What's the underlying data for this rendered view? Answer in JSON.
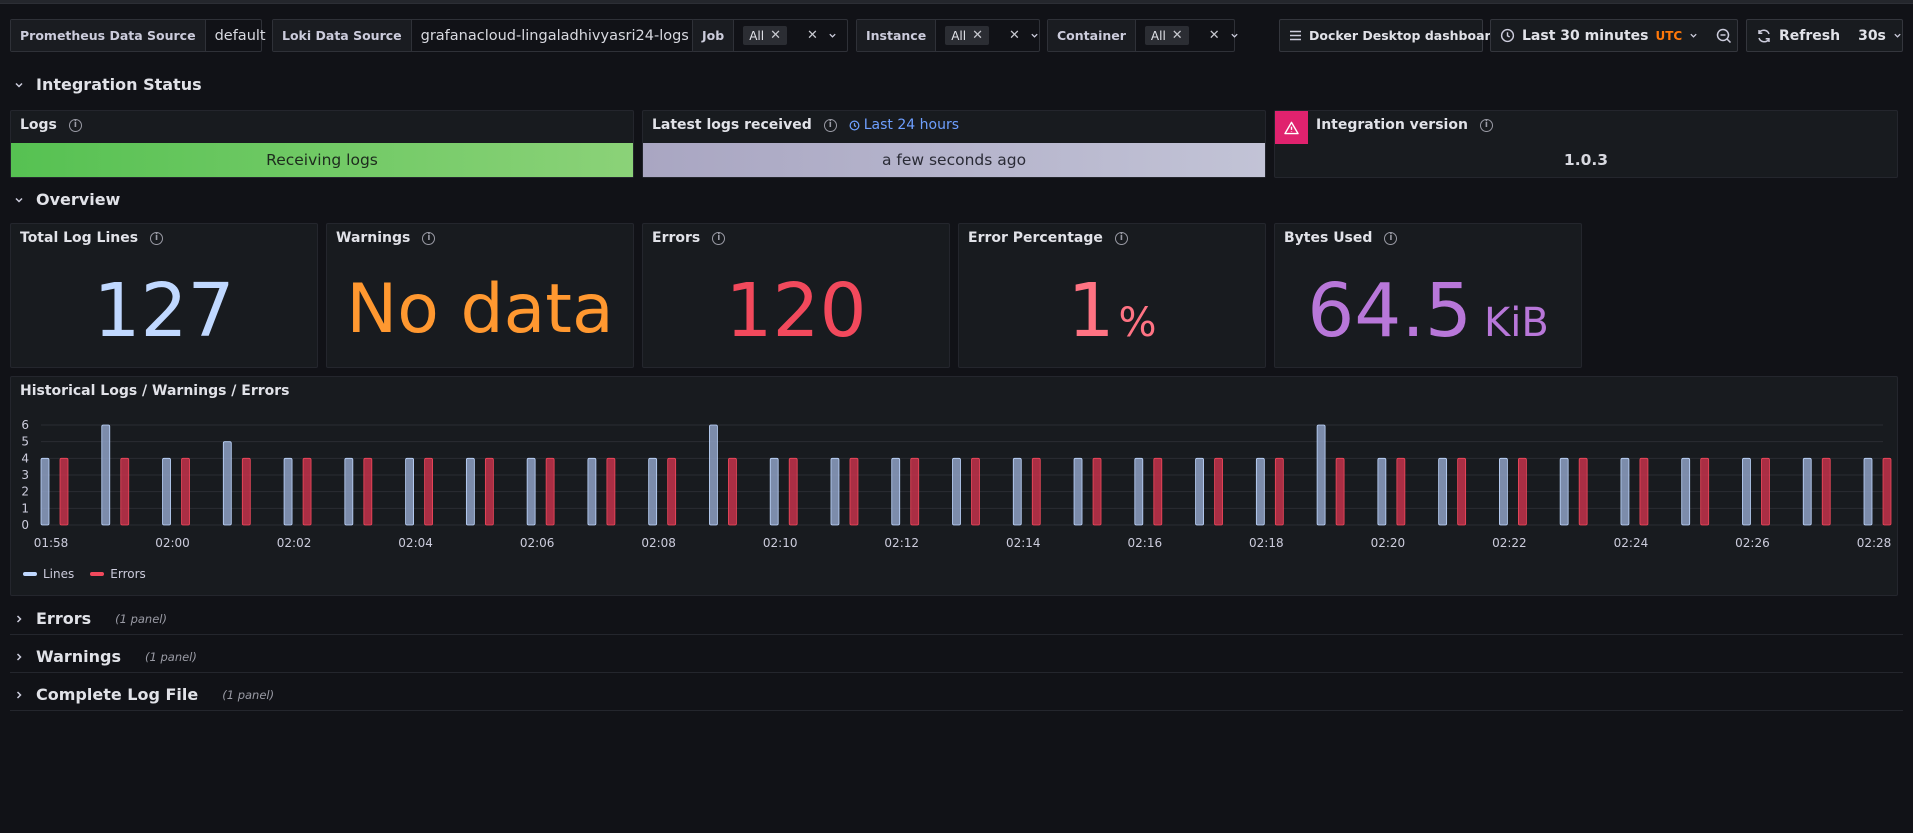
{
  "variables": {
    "prometheus": {
      "label": "Prometheus Data Source",
      "value": "default"
    },
    "loki": {
      "label": "Loki Data Source",
      "value": "grafanacloud-lingaladhivyasri24-logs"
    },
    "job": {
      "label": "Job",
      "value": "All"
    },
    "instance": {
      "label": "Instance",
      "value": "All"
    },
    "container": {
      "label": "Container",
      "value": "All"
    }
  },
  "toolbar": {
    "dashboards_link": "Docker Desktop dashboards",
    "time_range": "Last 30 minutes",
    "timezone": "UTC",
    "refresh_label": "Refresh",
    "refresh_interval": "30s"
  },
  "rows": {
    "integration_status": "Integration Status",
    "overview": "Overview",
    "errors": {
      "title": "Errors",
      "count": "(1 panel)"
    },
    "warnings": {
      "title": "Warnings",
      "count": "(1 panel)"
    },
    "complete_log": {
      "title": "Complete Log File",
      "count": "(1 panel)"
    }
  },
  "status_panels": {
    "logs": {
      "title": "Logs",
      "value": "Receiving logs"
    },
    "latest": {
      "title": "Latest logs received",
      "time_link": "Last 24 hours",
      "value": "a few seconds ago"
    },
    "version": {
      "title": "Integration version",
      "value": "1.0.3"
    }
  },
  "stats": {
    "total_log_lines": {
      "title": "Total Log Lines",
      "value": "127"
    },
    "warnings": {
      "title": "Warnings",
      "value": "No data"
    },
    "errors": {
      "title": "Errors",
      "value": "120"
    },
    "error_percentage": {
      "title": "Error Percentage",
      "value": "1",
      "unit": "%"
    },
    "bytes_used": {
      "title": "Bytes Used",
      "value": "64.5",
      "unit": "KiB"
    }
  },
  "colors": {
    "green": "#73bf69",
    "orange": "#ff9830",
    "red": "#f2495c",
    "pink": "#ff7383",
    "purple": "#b877d9",
    "blue": "#c0d8ff",
    "lines_bar": "#8ea0c4",
    "errors_bar": "#c4314b"
  },
  "chart_data": {
    "type": "bar",
    "title": "Historical Logs / Warnings / Errors",
    "x": [
      "01:58",
      "01:59",
      "02:00",
      "02:01",
      "02:02",
      "02:03",
      "02:04",
      "02:05",
      "02:06",
      "02:07",
      "02:08",
      "02:09",
      "02:10",
      "02:11",
      "02:12",
      "02:13",
      "02:14",
      "02:15",
      "02:16",
      "02:17",
      "02:18",
      "02:19",
      "02:20",
      "02:21",
      "02:22",
      "02:23",
      "02:24",
      "02:25",
      "02:26",
      "02:27",
      "02:28"
    ],
    "tick_labels": [
      "01:58",
      "02:00",
      "02:02",
      "02:04",
      "02:06",
      "02:08",
      "02:10",
      "02:12",
      "02:14",
      "02:16",
      "02:18",
      "02:20",
      "02:22",
      "02:24",
      "02:26",
      "02:28"
    ],
    "series": [
      {
        "name": "Lines",
        "values": [
          4,
          6,
          4,
          5,
          4,
          4,
          4,
          4,
          4,
          4,
          4,
          6,
          4,
          4,
          4,
          4,
          4,
          4,
          4,
          4,
          4,
          6,
          4,
          4,
          4,
          4,
          4,
          4,
          4,
          4,
          4
        ]
      },
      {
        "name": "Errors",
        "values": [
          4,
          4,
          4,
          4,
          4,
          4,
          4,
          4,
          4,
          4,
          4,
          4,
          4,
          4,
          4,
          4,
          4,
          4,
          4,
          4,
          4,
          4,
          4,
          4,
          4,
          4,
          4,
          4,
          4,
          4,
          4
        ]
      }
    ],
    "ylim": [
      0,
      6
    ],
    "yticks": [
      0,
      1,
      2,
      3,
      4,
      5,
      6
    ],
    "legend": "bottom-left",
    "grid": true
  }
}
